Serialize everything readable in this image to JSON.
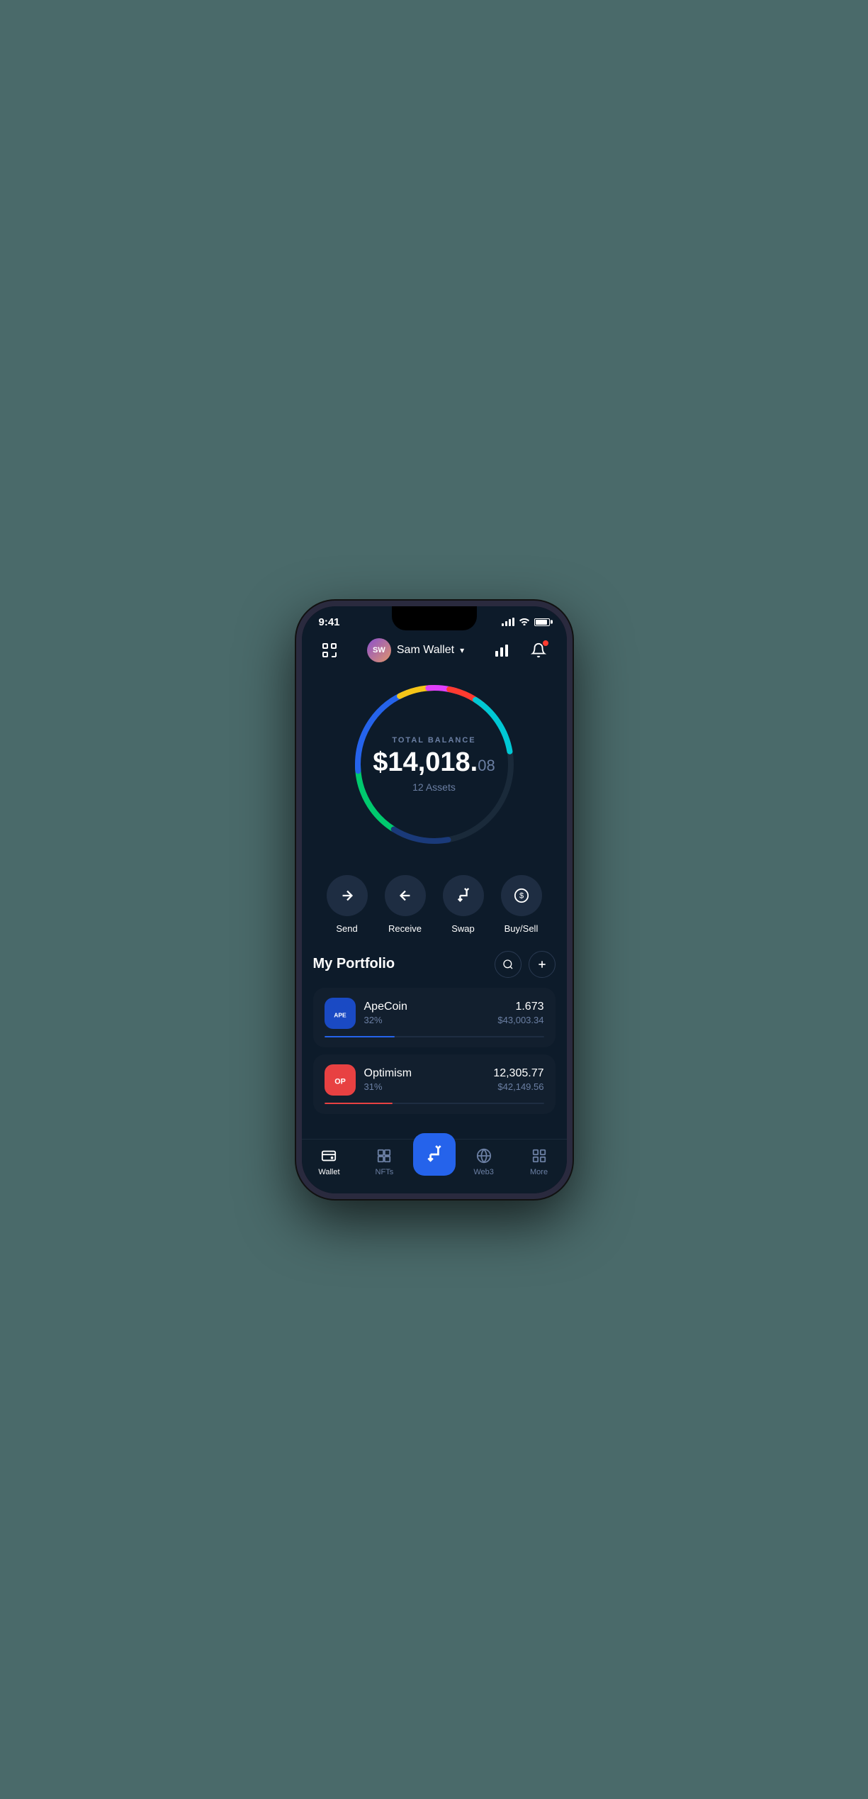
{
  "statusBar": {
    "time": "9:41"
  },
  "header": {
    "walletAvatarText": "SW",
    "walletName": "Sam Wallet",
    "scanIconLabel": "scan",
    "chartIconLabel": "chart",
    "bellIconLabel": "bell"
  },
  "balance": {
    "label": "TOTAL BALANCE",
    "whole": "$14,018.",
    "cents": "08",
    "assetsCount": "12 Assets"
  },
  "actions": [
    {
      "id": "send",
      "label": "Send",
      "icon": "→"
    },
    {
      "id": "receive",
      "label": "Receive",
      "icon": "←"
    },
    {
      "id": "swap",
      "label": "Swap",
      "icon": "⇅"
    },
    {
      "id": "buysell",
      "label": "Buy/Sell",
      "icon": "$"
    }
  ],
  "portfolio": {
    "title": "My Portfolio",
    "searchLabel": "search",
    "addLabel": "add",
    "assets": [
      {
        "name": "ApeCoin",
        "percent": "32%",
        "amount": "1.673",
        "usd": "$43,003.34",
        "progressWidth": "32",
        "progressColor": "#2563eb",
        "logoText": "APE",
        "logoBg": "#1a4ac4"
      },
      {
        "name": "Optimism",
        "percent": "31%",
        "amount": "12,305.77",
        "usd": "$42,149.56",
        "progressWidth": "31",
        "progressColor": "#e84142",
        "logoText": "OP",
        "logoBg": "#e84142"
      }
    ]
  },
  "bottomNav": [
    {
      "id": "wallet",
      "label": "Wallet",
      "active": true
    },
    {
      "id": "nfts",
      "label": "NFTs",
      "active": false
    },
    {
      "id": "center",
      "label": "",
      "active": false,
      "isCenter": true
    },
    {
      "id": "web3",
      "label": "Web3",
      "active": false
    },
    {
      "id": "more",
      "label": "More",
      "active": false
    }
  ],
  "colors": {
    "bg": "#0d1b2a",
    "cardBg": "#121f2e",
    "accent": "#2563eb",
    "textMuted": "#6b7fa3",
    "textWhite": "#ffffff"
  }
}
